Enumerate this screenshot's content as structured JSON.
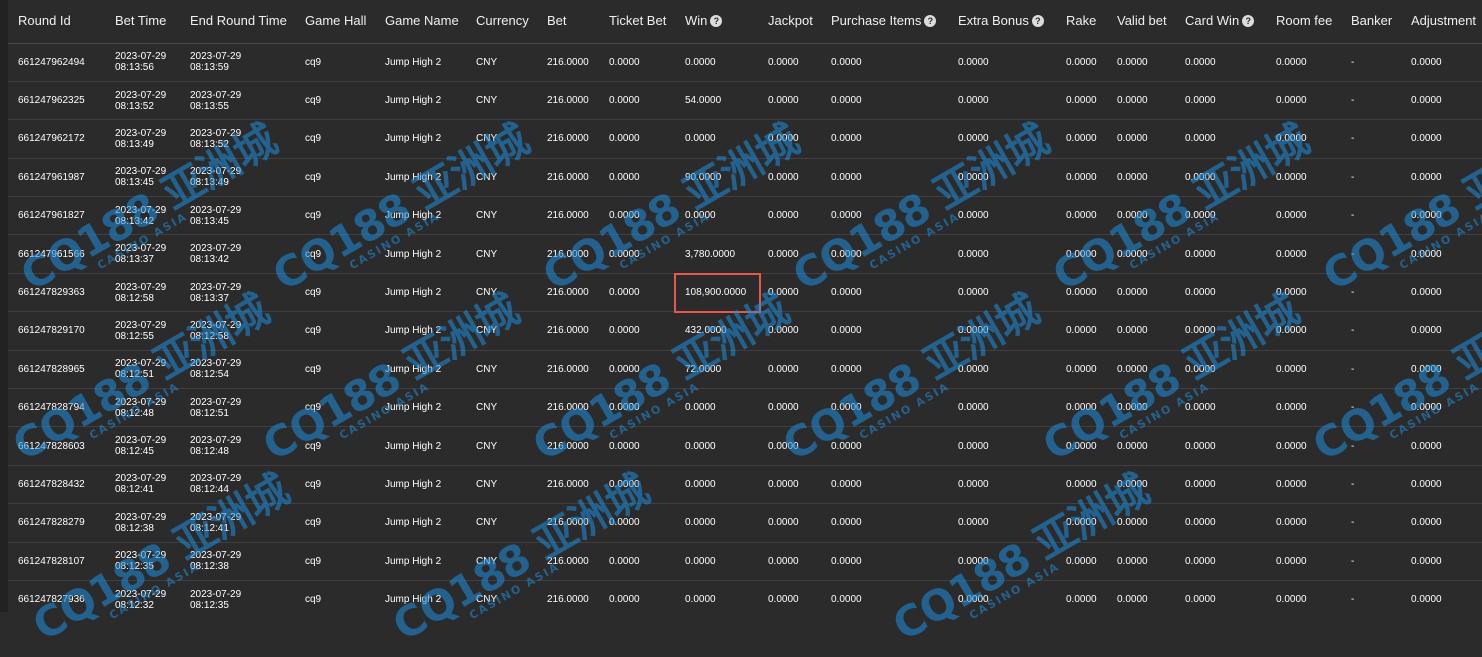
{
  "columns": [
    {
      "label": "Round Id",
      "help": false
    },
    {
      "label": "Bet Time",
      "help": false
    },
    {
      "label": "End Round Time",
      "help": false
    },
    {
      "label": "Game Hall",
      "help": false
    },
    {
      "label": "Game Name",
      "help": false
    },
    {
      "label": "Currency",
      "help": false
    },
    {
      "label": "Bet",
      "help": false
    },
    {
      "label": "Ticket Bet",
      "help": false
    },
    {
      "label": "Win",
      "help": true
    },
    {
      "label": "Jackpot",
      "help": false
    },
    {
      "label": "Purchase Items",
      "help": true
    },
    {
      "label": "Extra Bonus",
      "help": true
    },
    {
      "label": "Rake",
      "help": false
    },
    {
      "label": "Valid bet",
      "help": false
    },
    {
      "label": "Card Win",
      "help": true
    },
    {
      "label": "Room fee",
      "help": false
    },
    {
      "label": "Banker",
      "help": false
    },
    {
      "label": "Adjustment",
      "help": false
    }
  ],
  "help_icon": "question-circle-icon",
  "highlight_row_index": 6,
  "highlight_color": "#e5584b",
  "watermark": {
    "main": "CQ188 亚洲城",
    "sub": "CASINO ASIA",
    "color": "#1e90e0"
  },
  "rows": [
    {
      "round_id": "661247962494",
      "bet_date": "2023-07-29",
      "bet_clock": "08:13:56",
      "end_date": "2023-07-29",
      "end_clock": "08:13:59",
      "hall": "cq9",
      "game": "Jump High 2",
      "currency": "CNY",
      "bet": "216.0000",
      "ticket_bet": "0.0000",
      "win": "0.0000",
      "jackpot": "0.0000",
      "purchase": "0.0000",
      "extra": "0.0000",
      "rake": "0.0000",
      "valid": "0.0000",
      "card_win": "0.0000",
      "room_fee": "0.0000",
      "banker": "-",
      "adjustment": "0.0000"
    },
    {
      "round_id": "661247962325",
      "bet_date": "2023-07-29",
      "bet_clock": "08:13:52",
      "end_date": "2023-07-29",
      "end_clock": "08:13:55",
      "hall": "cq9",
      "game": "Jump High 2",
      "currency": "CNY",
      "bet": "216.0000",
      "ticket_bet": "0.0000",
      "win": "54.0000",
      "jackpot": "0.0000",
      "purchase": "0.0000",
      "extra": "0.0000",
      "rake": "0.0000",
      "valid": "0.0000",
      "card_win": "0.0000",
      "room_fee": "0.0000",
      "banker": "-",
      "adjustment": "0.0000"
    },
    {
      "round_id": "661247962172",
      "bet_date": "2023-07-29",
      "bet_clock": "08:13:49",
      "end_date": "2023-07-29",
      "end_clock": "08:13:52",
      "hall": "cq9",
      "game": "Jump High 2",
      "currency": "CNY",
      "bet": "216.0000",
      "ticket_bet": "0.0000",
      "win": "0.0000",
      "jackpot": "0.0000",
      "purchase": "0.0000",
      "extra": "0.0000",
      "rake": "0.0000",
      "valid": "0.0000",
      "card_win": "0.0000",
      "room_fee": "0.0000",
      "banker": "-",
      "adjustment": "0.0000"
    },
    {
      "round_id": "661247961987",
      "bet_date": "2023-07-29",
      "bet_clock": "08:13:45",
      "end_date": "2023-07-29",
      "end_clock": "08:13:49",
      "hall": "cq9",
      "game": "Jump High 2",
      "currency": "CNY",
      "bet": "216.0000",
      "ticket_bet": "0.0000",
      "win": "90.0000",
      "jackpot": "0.0000",
      "purchase": "0.0000",
      "extra": "0.0000",
      "rake": "0.0000",
      "valid": "0.0000",
      "card_win": "0.0000",
      "room_fee": "0.0000",
      "banker": "-",
      "adjustment": "0.0000"
    },
    {
      "round_id": "661247961827",
      "bet_date": "2023-07-29",
      "bet_clock": "08:13:42",
      "end_date": "2023-07-29",
      "end_clock": "08:13:45",
      "hall": "cq9",
      "game": "Jump High 2",
      "currency": "CNY",
      "bet": "216.0000",
      "ticket_bet": "0.0000",
      "win": "0.0000",
      "jackpot": "0.0000",
      "purchase": "0.0000",
      "extra": "0.0000",
      "rake": "0.0000",
      "valid": "0.0000",
      "card_win": "0.0000",
      "room_fee": "0.0000",
      "banker": "-",
      "adjustment": "0.0000"
    },
    {
      "round_id": "661247961566",
      "bet_date": "2023-07-29",
      "bet_clock": "08:13:37",
      "end_date": "2023-07-29",
      "end_clock": "08:13:42",
      "hall": "cq9",
      "game": "Jump High 2",
      "currency": "CNY",
      "bet": "216.0000",
      "ticket_bet": "0.0000",
      "win": "3,780.0000",
      "jackpot": "0.0000",
      "purchase": "0.0000",
      "extra": "0.0000",
      "rake": "0.0000",
      "valid": "0.0000",
      "card_win": "0.0000",
      "room_fee": "0.0000",
      "banker": "-",
      "adjustment": "0.0000"
    },
    {
      "round_id": "661247829363",
      "bet_date": "2023-07-29",
      "bet_clock": "08:12:58",
      "end_date": "2023-07-29",
      "end_clock": "08:13:37",
      "hall": "cq9",
      "game": "Jump High 2",
      "currency": "CNY",
      "bet": "216.0000",
      "ticket_bet": "0.0000",
      "win": "108,900.0000",
      "jackpot": "0.0000",
      "purchase": "0.0000",
      "extra": "0.0000",
      "rake": "0.0000",
      "valid": "0.0000",
      "card_win": "0.0000",
      "room_fee": "0.0000",
      "banker": "-",
      "adjustment": "0.0000"
    },
    {
      "round_id": "661247829170",
      "bet_date": "2023-07-29",
      "bet_clock": "08:12:55",
      "end_date": "2023-07-29",
      "end_clock": "08:12:58",
      "hall": "cq9",
      "game": "Jump High 2",
      "currency": "CNY",
      "bet": "216.0000",
      "ticket_bet": "0.0000",
      "win": "432.0000",
      "jackpot": "0.0000",
      "purchase": "0.0000",
      "extra": "0.0000",
      "rake": "0.0000",
      "valid": "0.0000",
      "card_win": "0.0000",
      "room_fee": "0.0000",
      "banker": "-",
      "adjustment": "0.0000"
    },
    {
      "round_id": "661247828965",
      "bet_date": "2023-07-29",
      "bet_clock": "08:12:51",
      "end_date": "2023-07-29",
      "end_clock": "08:12:54",
      "hall": "cq9",
      "game": "Jump High 2",
      "currency": "CNY",
      "bet": "216.0000",
      "ticket_bet": "0.0000",
      "win": "72.0000",
      "jackpot": "0.0000",
      "purchase": "0.0000",
      "extra": "0.0000",
      "rake": "0.0000",
      "valid": "0.0000",
      "card_win": "0.0000",
      "room_fee": "0.0000",
      "banker": "-",
      "adjustment": "0.0000"
    },
    {
      "round_id": "661247828794",
      "bet_date": "2023-07-29",
      "bet_clock": "08:12:48",
      "end_date": "2023-07-29",
      "end_clock": "08:12:51",
      "hall": "cq9",
      "game": "Jump High 2",
      "currency": "CNY",
      "bet": "216.0000",
      "ticket_bet": "0.0000",
      "win": "0.0000",
      "jackpot": "0.0000",
      "purchase": "0.0000",
      "extra": "0.0000",
      "rake": "0.0000",
      "valid": "0.0000",
      "card_win": "0.0000",
      "room_fee": "0.0000",
      "banker": "-",
      "adjustment": "0.0000"
    },
    {
      "round_id": "661247828603",
      "bet_date": "2023-07-29",
      "bet_clock": "08:12:45",
      "end_date": "2023-07-29",
      "end_clock": "08:12:48",
      "hall": "cq9",
      "game": "Jump High 2",
      "currency": "CNY",
      "bet": "216.0000",
      "ticket_bet": "0.0000",
      "win": "0.0000",
      "jackpot": "0.0000",
      "purchase": "0.0000",
      "extra": "0.0000",
      "rake": "0.0000",
      "valid": "0.0000",
      "card_win": "0.0000",
      "room_fee": "0.0000",
      "banker": "-",
      "adjustment": "0.0000"
    },
    {
      "round_id": "661247828432",
      "bet_date": "2023-07-29",
      "bet_clock": "08:12:41",
      "end_date": "2023-07-29",
      "end_clock": "08:12:44",
      "hall": "cq9",
      "game": "Jump High 2",
      "currency": "CNY",
      "bet": "216.0000",
      "ticket_bet": "0.0000",
      "win": "0.0000",
      "jackpot": "0.0000",
      "purchase": "0.0000",
      "extra": "0.0000",
      "rake": "0.0000",
      "valid": "0.0000",
      "card_win": "0.0000",
      "room_fee": "0.0000",
      "banker": "-",
      "adjustment": "0.0000"
    },
    {
      "round_id": "661247828279",
      "bet_date": "2023-07-29",
      "bet_clock": "08:12:38",
      "end_date": "2023-07-29",
      "end_clock": "08:12:41",
      "hall": "cq9",
      "game": "Jump High 2",
      "currency": "CNY",
      "bet": "216.0000",
      "ticket_bet": "0.0000",
      "win": "0.0000",
      "jackpot": "0.0000",
      "purchase": "0.0000",
      "extra": "0.0000",
      "rake": "0.0000",
      "valid": "0.0000",
      "card_win": "0.0000",
      "room_fee": "0.0000",
      "banker": "-",
      "adjustment": "0.0000"
    },
    {
      "round_id": "661247828107",
      "bet_date": "2023-07-29",
      "bet_clock": "08:12:35",
      "end_date": "2023-07-29",
      "end_clock": "08:12:38",
      "hall": "cq9",
      "game": "Jump High 2",
      "currency": "CNY",
      "bet": "216.0000",
      "ticket_bet": "0.0000",
      "win": "0.0000",
      "jackpot": "0.0000",
      "purchase": "0.0000",
      "extra": "0.0000",
      "rake": "0.0000",
      "valid": "0.0000",
      "card_win": "0.0000",
      "room_fee": "0.0000",
      "banker": "-",
      "adjustment": "0.0000"
    },
    {
      "round_id": "661247827936",
      "bet_date": "2023-07-29",
      "bet_clock": "08:12:32",
      "end_date": "2023-07-29",
      "end_clock": "08:12:35",
      "hall": "cq9",
      "game": "Jump High 2",
      "currency": "CNY",
      "bet": "216.0000",
      "ticket_bet": "0.0000",
      "win": "0.0000",
      "jackpot": "0.0000",
      "purchase": "0.0000",
      "extra": "0.0000",
      "rake": "0.0000",
      "valid": "0.0000",
      "card_win": "0.0000",
      "room_fee": "0.0000",
      "banker": "-",
      "adjustment": "0.0000"
    }
  ]
}
